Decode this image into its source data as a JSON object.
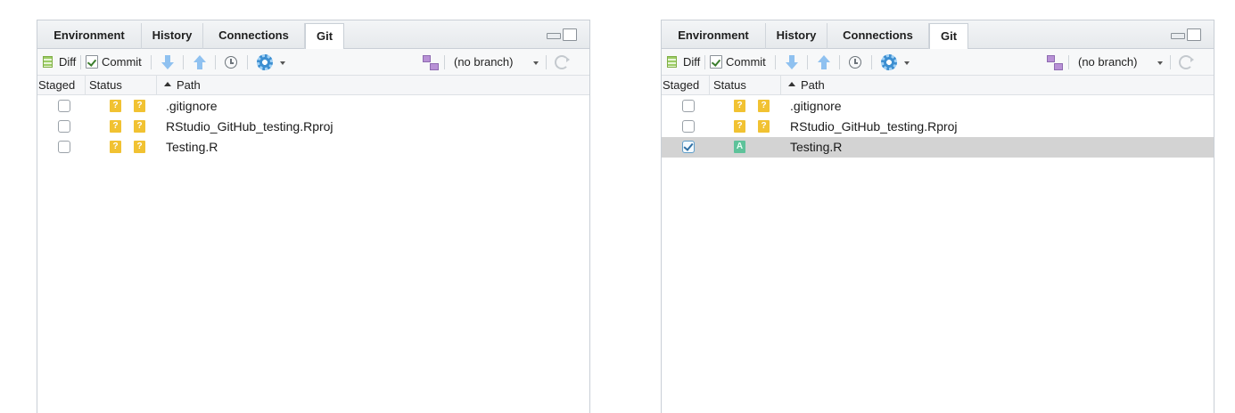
{
  "panes": [
    {
      "tabs": [
        "Environment",
        "History",
        "Connections",
        "Git"
      ],
      "active_tab": "Git",
      "toolbar": {
        "diff_label": "Diff",
        "commit_label": "Commit",
        "branch_label": "(no branch)"
      },
      "columns": {
        "staged": "Staged",
        "status": "Status",
        "path": "Path"
      },
      "files": [
        {
          "staged": false,
          "status": [
            "?",
            "?"
          ],
          "path": ".gitignore",
          "selected": false
        },
        {
          "staged": false,
          "status": [
            "?",
            "?"
          ],
          "path": "RStudio_GitHub_testing.Rproj",
          "selected": false
        },
        {
          "staged": false,
          "status": [
            "?",
            "?"
          ],
          "path": "Testing.R",
          "selected": false
        }
      ]
    },
    {
      "tabs": [
        "Environment",
        "History",
        "Connections",
        "Git"
      ],
      "active_tab": "Git",
      "toolbar": {
        "diff_label": "Diff",
        "commit_label": "Commit",
        "branch_label": "(no branch)"
      },
      "columns": {
        "staged": "Staged",
        "status": "Status",
        "path": "Path"
      },
      "files": [
        {
          "staged": false,
          "status": [
            "?",
            "?"
          ],
          "path": ".gitignore",
          "selected": false
        },
        {
          "staged": false,
          "status": [
            "?",
            "?"
          ],
          "path": "RStudio_GitHub_testing.Rproj",
          "selected": false
        },
        {
          "staged": true,
          "status": [
            "A"
          ],
          "path": "Testing.R",
          "selected": true
        }
      ]
    }
  ],
  "colors": {
    "untracked_badge": "#f1c232",
    "added_badge": "#5ec29a",
    "selected_row": "#d3d3d3"
  }
}
